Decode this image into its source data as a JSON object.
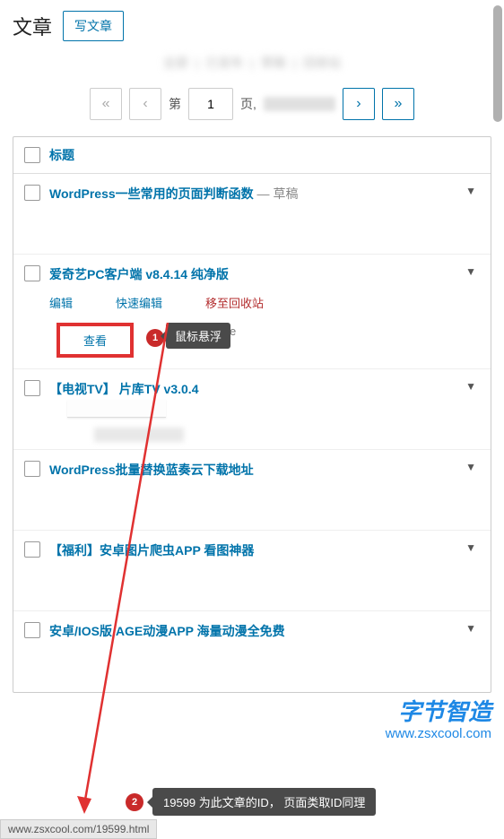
{
  "header": {
    "title": "文章",
    "write_btn": "写文章"
  },
  "subnav": {
    "a": "全部",
    "b": "已发布",
    "c": "草稿",
    "d": "回收站"
  },
  "pagination": {
    "first": "«",
    "prev": "‹",
    "next": "›",
    "last": "»",
    "prefix": "第",
    "current": "1",
    "suffix": "页,"
  },
  "table": {
    "header_title": "标题",
    "rows": [
      {
        "title": "WordPress一些常用的页面判断函数",
        "suffix": " — 草稿"
      },
      {
        "title": "爱奇艺PC客户端 v8.4.14 纯净版",
        "actions": {
          "edit": "编辑",
          "quick": "快速编辑",
          "trash": "移至回收站",
          "view": "查看",
          "clear_cache": "Clear Cache"
        }
      },
      {
        "title": "【电视TV】 片库TV v3.0.4"
      },
      {
        "title": "WordPress批量替换蓝奏云下载地址"
      },
      {
        "title": "【福利】安卓图片爬虫APP 看图神器"
      },
      {
        "title": "安卓/IOS版 AGE动漫APP 海量动漫全免费"
      }
    ]
  },
  "annotations": {
    "hover_tip": "鼠标悬浮",
    "bottom_tip": "19599 为此文章的ID，  页面类取ID同理",
    "badge1": "1",
    "badge2": "2"
  },
  "watermark": {
    "main": "字节智造",
    "url": "www.zsxcool.com"
  },
  "status_bar": {
    "url": "www.zsxcool.com/19599.html"
  }
}
